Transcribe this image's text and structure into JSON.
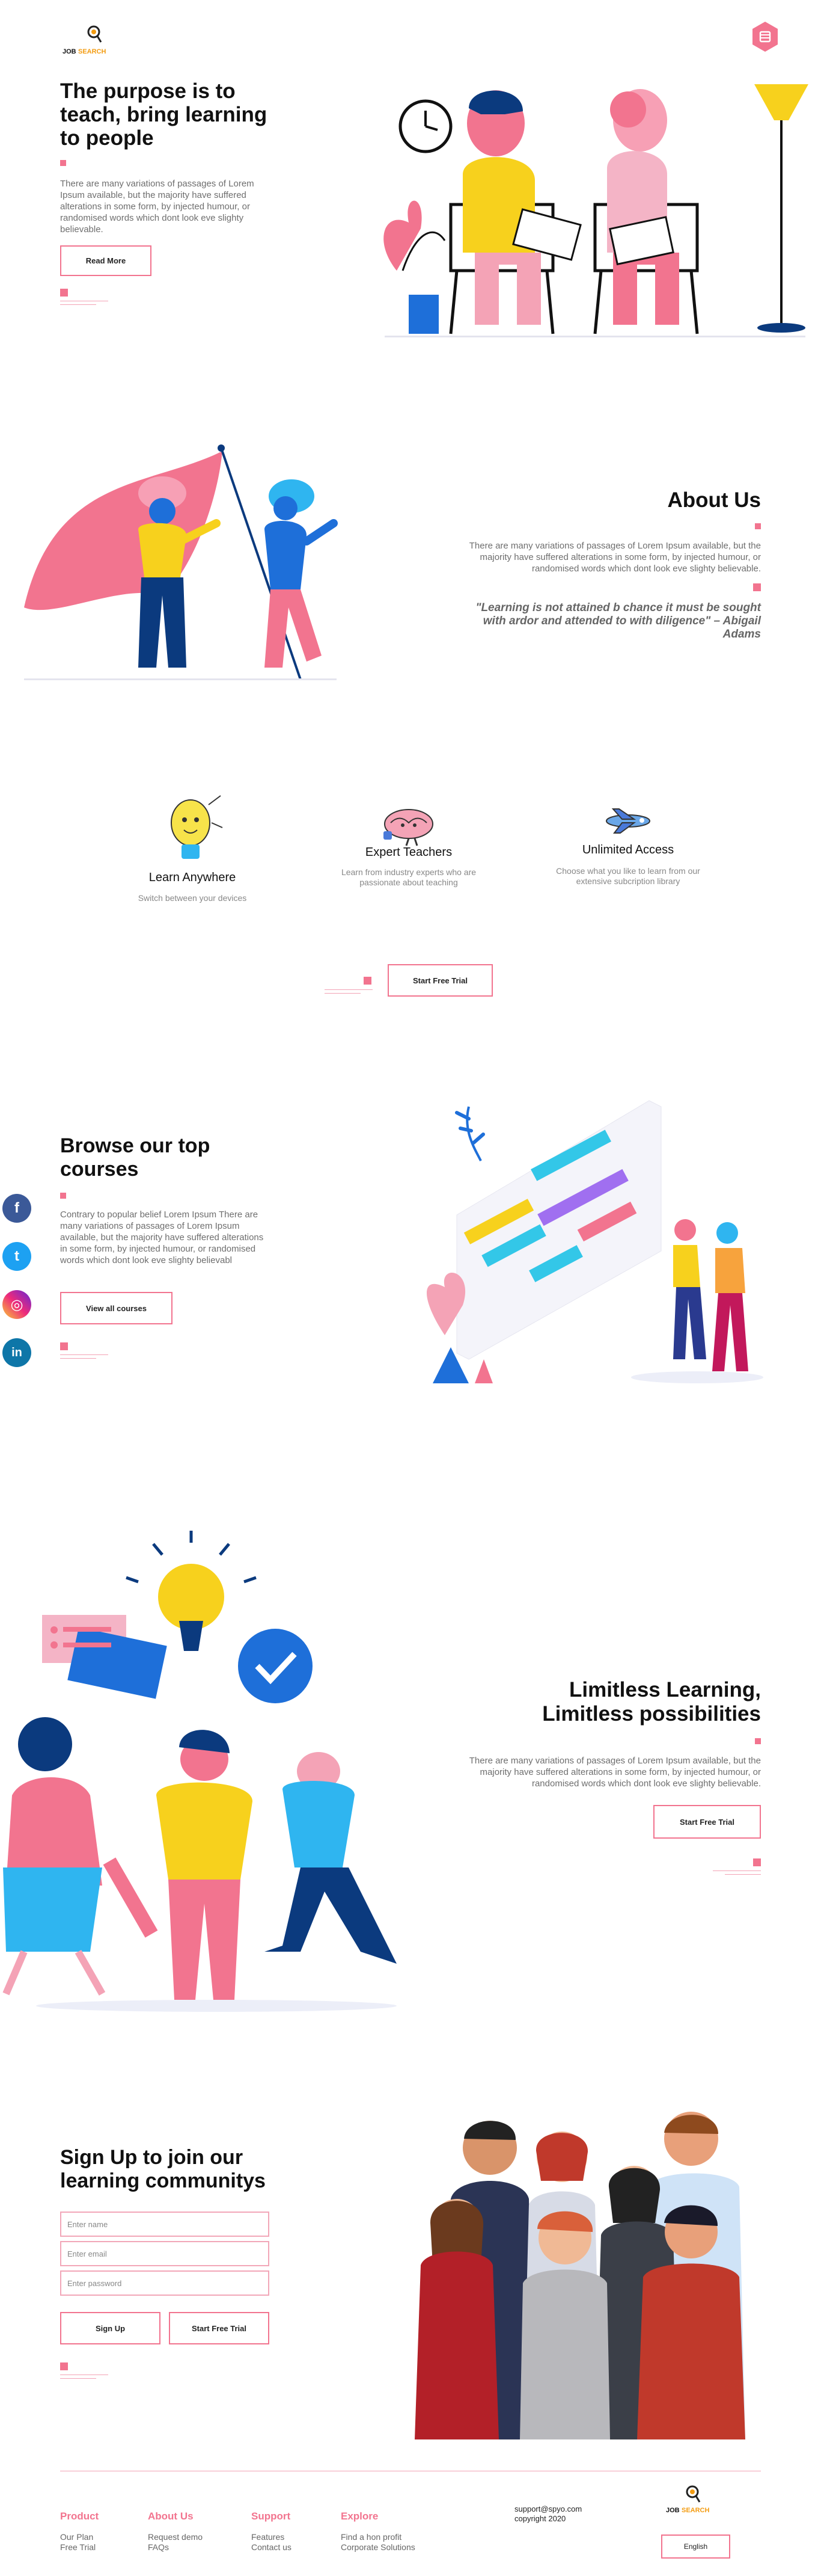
{
  "brand": {
    "logo_line1": "JOB",
    "logo_line2": "SEARCH"
  },
  "colors": {
    "accent": "#f2748f",
    "accent_light": "#f3a2b5",
    "logo_orange": "#f39c12"
  },
  "menu": {
    "icon": "menu-icon"
  },
  "hero": {
    "title": "The purpose is to teach, bring learning to people",
    "text": "There are many variations of passages of Lorem Ipsum available, but the majority have suffered alterations in some form, by injected humour, or randomised words which dont look eve slighty believable.",
    "button": "Read More"
  },
  "about": {
    "title": "About Us",
    "text": "There are many variations of passages of Lorem Ipsum available, but the majority have suffered alterations in some form, by injected humour, or randomised words which dont look eve slighty believable.",
    "quote": "\"Learning is not attained b chance it must be sought with ardor and attended to with diligence\" – Abigail Adams"
  },
  "features": {
    "items": [
      {
        "title": "Learn Anywhere",
        "text": "Switch between your devices",
        "icon": "lightbulb-icon"
      },
      {
        "title": "Expert Teachers",
        "text": "Learn from industry experts who are passionate about teaching",
        "icon": "brain-icon"
      },
      {
        "title": "Unlimited Access",
        "text": "Choose what you like to learn from our extensive subcription library",
        "icon": "airplane-icon"
      }
    ],
    "button": "Start Free Trial"
  },
  "courses": {
    "title": "Browse our top courses",
    "text": "Contrary to popular belief Lorem Ipsum There are many variations of passages of Lorem Ipsum available, but the majority have suffered alterations in some form, by injected humour, or randomised words which dont look eve slighty believabl",
    "button": "View all courses"
  },
  "social": [
    {
      "name": "facebook-icon",
      "glyph": "f",
      "color": "#3b5998"
    },
    {
      "name": "twitter-icon",
      "glyph": "t",
      "color": "#1da1f2"
    },
    {
      "name": "instagram-icon",
      "glyph": "◎",
      "color": "#c13584"
    },
    {
      "name": "linkedin-icon",
      "glyph": "in",
      "color": "#0e76a8"
    }
  ],
  "limitless": {
    "title_line1": "Limitless Learning,",
    "title_line2": "Limitless possibilities",
    "text": "There are many variations of passages of Lorem Ipsum available, but the majority have suffered alterations in some form, by injected humour, or randomised words which dont look eve slighty believable.",
    "button": "Start Free Trial"
  },
  "signup": {
    "title": "Sign Up to join our learning communitys",
    "name_placeholder": "Enter name",
    "email_placeholder": "Enter email",
    "password_placeholder": "Enter password",
    "signup_button": "Sign Up",
    "trial_button": "Start Free Trial"
  },
  "footer": {
    "columns": [
      {
        "heading": "Product",
        "links": [
          "Our Plan",
          "Free Trial"
        ]
      },
      {
        "heading": "About Us",
        "links": [
          "Request demo",
          "FAQs"
        ]
      },
      {
        "heading": "Support",
        "links": [
          "Features",
          "Contact us"
        ]
      },
      {
        "heading": "Explore",
        "links": [
          "Find a hon profit",
          "Corporate Solutions"
        ]
      }
    ],
    "email": "support@spyo.com",
    "copyright": "copyright 2020",
    "language": "English"
  }
}
